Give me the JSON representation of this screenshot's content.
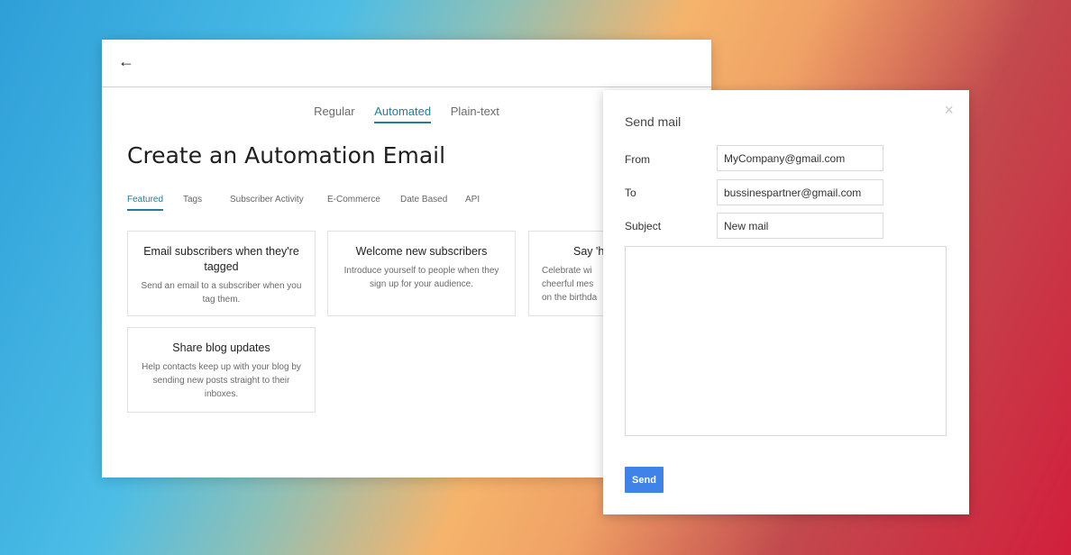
{
  "main": {
    "back_icon": "←",
    "type_tabs": [
      {
        "label": "Regular"
      },
      {
        "label": "Automated"
      },
      {
        "label": "Plain-text"
      }
    ],
    "page_title": "Create an Automation Email",
    "category_tabs": [
      {
        "label": "Featured"
      },
      {
        "label": "Tags"
      },
      {
        "label": "Subscriber Activity"
      },
      {
        "label": "E-Commerce"
      },
      {
        "label": "Date Based"
      },
      {
        "label": "API"
      }
    ],
    "cards": [
      {
        "title": "Email subscribers when they're tagged",
        "desc": "Send an email to a subscriber when you tag them."
      },
      {
        "title": "Welcome new subscribers",
        "desc": "Introduce yourself to people when they sign up for your audience."
      },
      {
        "title": "Say 'h",
        "desc": "Celebrate wi\ncheerful mes\non the birthda"
      },
      {
        "title": "Share blog updates",
        "desc": "Help contacts keep up with your blog by sending new posts straight to their inboxes."
      }
    ]
  },
  "dialog": {
    "title": "Send mail",
    "close_icon": "×",
    "from_label": "From",
    "from_value": "MyCompany@gmail.com",
    "to_label": "To",
    "to_value": "bussinespartner@gmail.com",
    "subject_label": "Subject",
    "subject_value": "New mail",
    "body_value": "",
    "send_label": "Send"
  },
  "colors": {
    "accent": "#237d99",
    "send_button": "#3f82e8"
  }
}
